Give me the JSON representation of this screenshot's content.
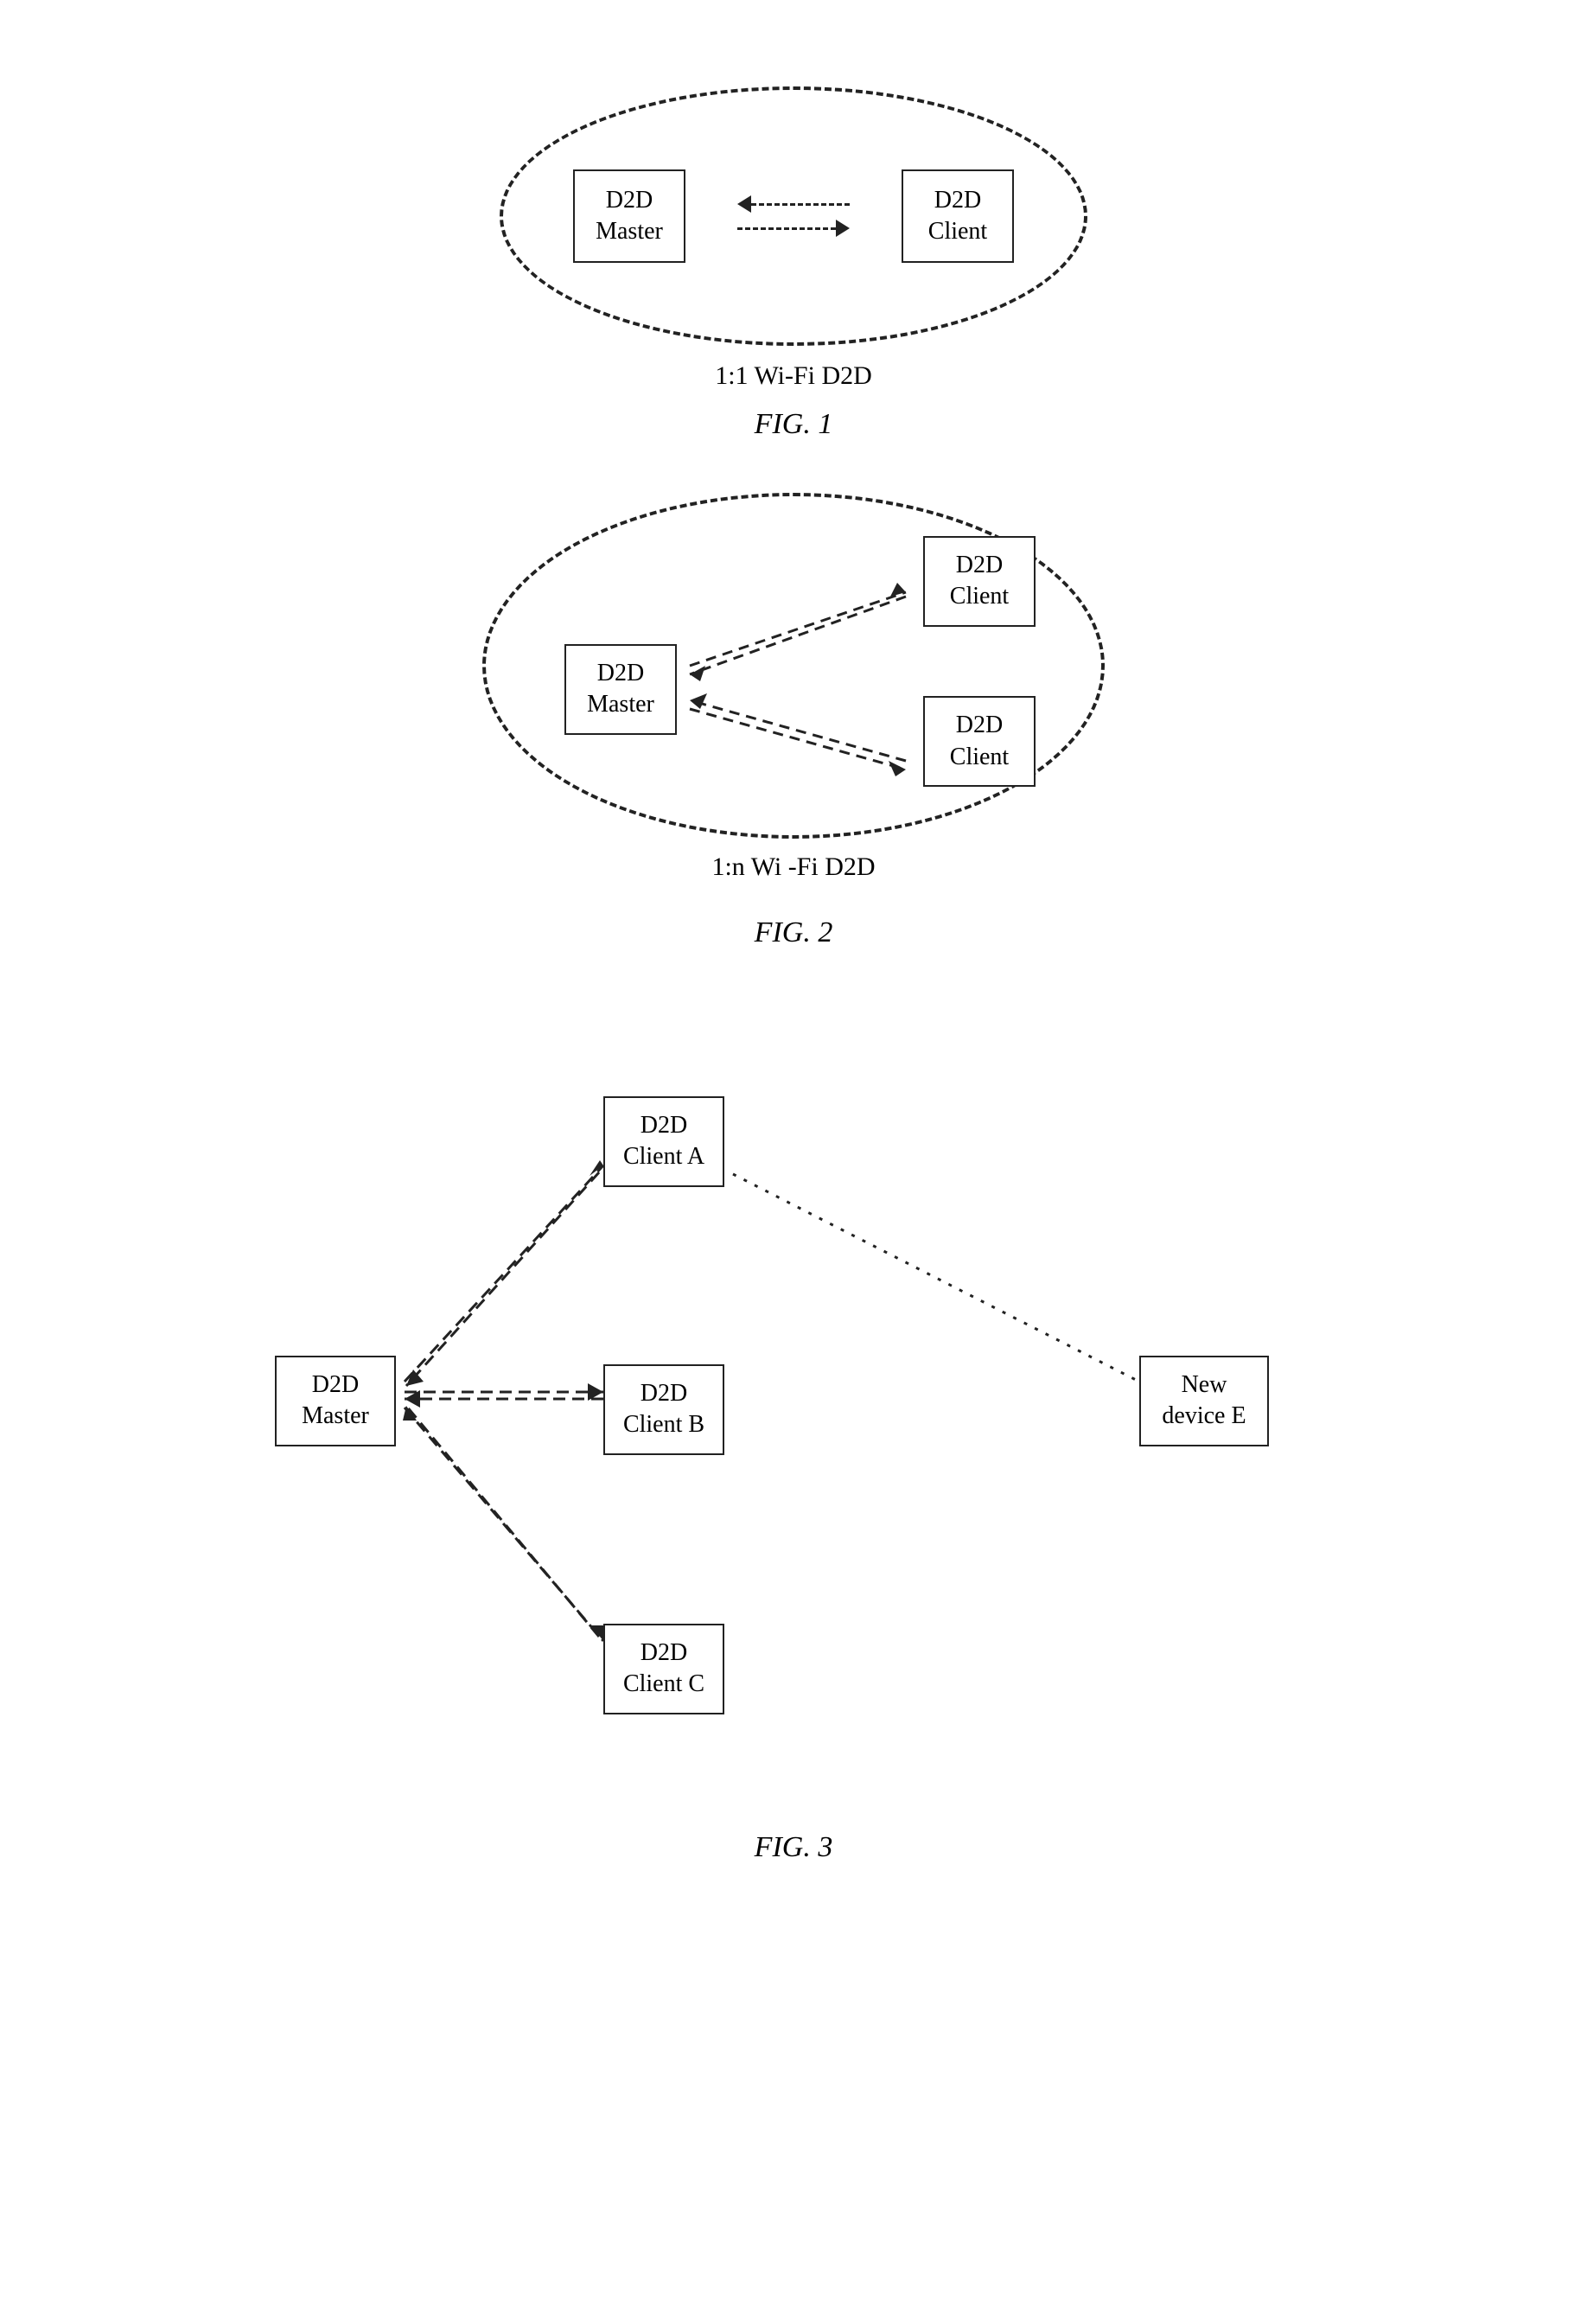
{
  "fig1": {
    "master_label": "D2D\nMaster",
    "client_label": "D2D\nClient",
    "caption": "1:1 Wi-Fi D2D",
    "fig_label": "FIG. 1"
  },
  "fig2": {
    "master_label": "D2D\nMaster",
    "client1_label": "D2D\nClient",
    "client2_label": "D2D\nClient",
    "caption": "1:n Wi -Fi D2D",
    "fig_label": "FIG. 2"
  },
  "fig3": {
    "master_label": "D2D\nMaster",
    "clientA_label": "D2D\nClient A",
    "clientB_label": "D2D\nClient B",
    "clientC_label": "D2D\nClient C",
    "newE_label": "New\ndevice E",
    "fig_label": "FIG. 3"
  }
}
